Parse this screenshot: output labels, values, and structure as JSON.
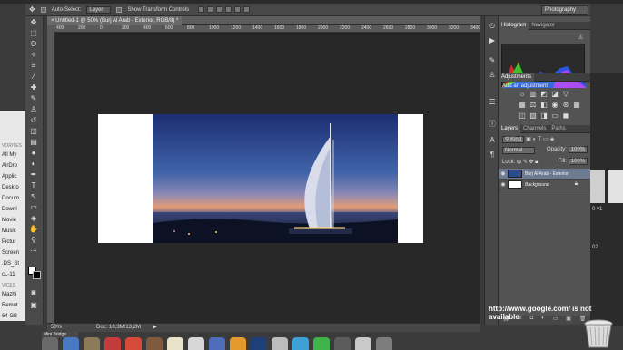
{
  "options_bar": {
    "auto_select_label": "Auto-Select:",
    "auto_select_target": "Layer",
    "show_transform_label": "Show Transform Controls",
    "workspace": "Photography"
  },
  "document": {
    "tab_title": "Untitled-1 @ 50% (Burj Al Arab - Exterior, RGB/8) *",
    "ruler_ticks": [
      "400",
      "200",
      "0",
      "200",
      "400",
      "600",
      "800",
      "1000",
      "1200",
      "1400",
      "1600",
      "1800",
      "2000",
      "2200",
      "2400",
      "2600",
      "2800",
      "3000",
      "3200",
      "3400"
    ],
    "zoom": "50%",
    "doc_size": "Doc: 10,3M/13,2M"
  },
  "panels": {
    "histogram_tabs": [
      "Histogram",
      "Navigator"
    ],
    "adjustments_title": "Add an adjustment",
    "adjustments_tab": "Adjustments",
    "layers_tabs": [
      "Layers",
      "Channels",
      "Paths"
    ],
    "kind_label": "Kind",
    "blend_mode": "Normal",
    "opacity_label": "Opacity:",
    "opacity_value": "100%",
    "lock_label": "Lock:",
    "fill_label": "Fill:",
    "fill_value": "100%",
    "layers": [
      {
        "name": "Burj Al Arab - Exterior",
        "selected": true
      },
      {
        "name": "Background",
        "selected": false
      }
    ]
  },
  "finder": {
    "section_favorites": "VORITES",
    "items": [
      "All My",
      "AirDro",
      "Applic",
      "Deskto",
      "Docum",
      "Downl",
      "Movie",
      "Music",
      "Pictur",
      "Screen",
      ".DS_St",
      "cL-11"
    ],
    "section_devices": "VICES",
    "devices": [
      "Mazhi",
      "Remot",
      "64 GB"
    ]
  },
  "dock": {
    "mini_bridge": "Mini Bridge"
  },
  "notice": "http://www.google.com/ is not available",
  "right_thumbs": [
    "0 v1",
    "02"
  ],
  "colors": {
    "accent_layer": "#6d7b92",
    "canvas_bg": "#282828",
    "panel_bg": "#535353"
  }
}
